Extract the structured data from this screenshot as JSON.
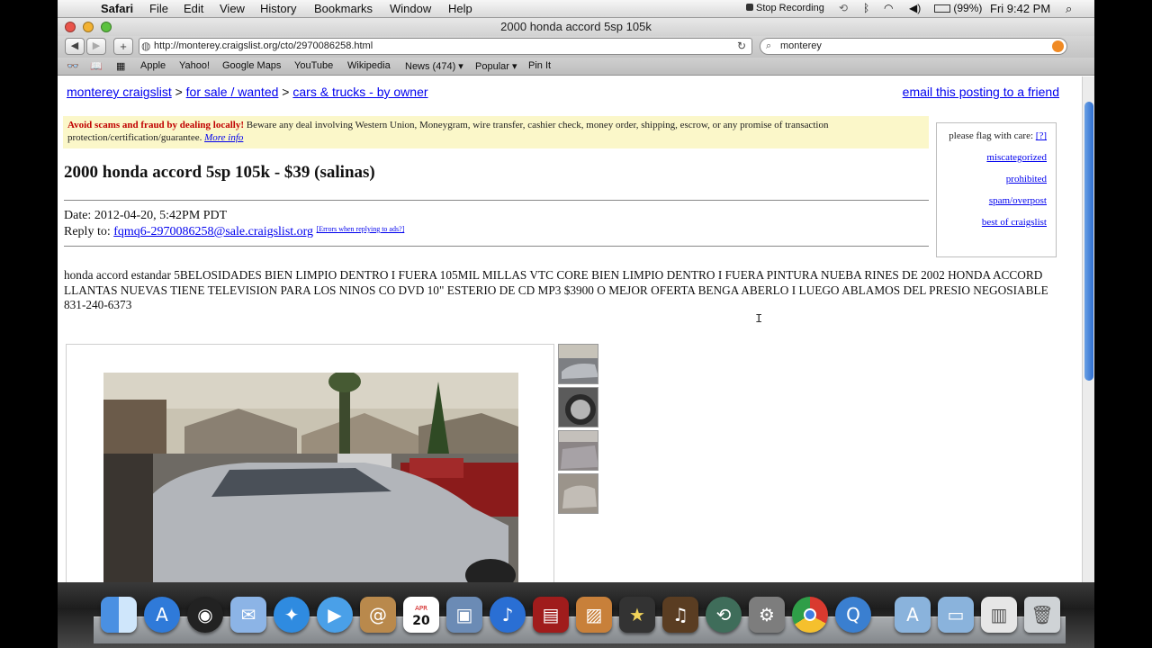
{
  "menubar": {
    "apple_icon": "apple-icon",
    "app_name": "Safari",
    "items": [
      "File",
      "Edit",
      "View",
      "History",
      "Bookmarks",
      "Window",
      "Help"
    ],
    "stop_recording": "Stop Recording",
    "battery": "(99%)",
    "clock": "Fri 9:42 PM"
  },
  "window": {
    "title": "2000 honda accord 5sp 105k"
  },
  "toolbar": {
    "back_label": "◀",
    "forward_label": "▶",
    "add_label": "+",
    "url": "http://monterey.craigslist.org/cto/2970086258.html",
    "search_value": "monterey"
  },
  "bookmarks": [
    "Apple",
    "Yahoo!",
    "Google Maps",
    "YouTube",
    "Wikipedia",
    "News (474) ▾",
    "Popular ▾",
    "Pin It"
  ],
  "page": {
    "breadcrumb": {
      "site": "monterey craigslist",
      "section": "for sale / wanted",
      "category": "cars & trucks - by owner",
      "sep": ">"
    },
    "email_link": "email this posting to a friend",
    "warning": {
      "strong": "Avoid scams and fraud by dealing locally!",
      "text": " Beware any deal involving Western Union, Moneygram, wire transfer, cashier check, money order, shipping, escrow, or any promise of transaction protection/certification/guarantee.",
      "more": "More info"
    },
    "flag": {
      "label": "please flag with care:",
      "help": "[?]",
      "options": [
        "miscategorized",
        "prohibited",
        "spam/overpost",
        "best of craigslist"
      ]
    },
    "title": "2000 honda accord 5sp 105k - $39 (salinas)",
    "date": "Date: 2012-04-20, 5:42PM PDT",
    "reply_prefix": "Reply to:",
    "reply_email": "fqmq6-2970086258@sale.craigslist.org",
    "reply_note": "[Errors when replying to ads?]",
    "body": "honda accord estandar 5BELOSIDADES BIEN LIMPIO DENTRO I FUERA 105MIL MILLAS VTC CORE BIEN LIMPIO DENTRO I FUERA PINTURA NUEBA RINES DE 2002 HONDA ACCORD LLANTAS NUEVAS TIENE TELEVISION PARA LOS NINOS CO DVD 10\" ESTERIO DE CD MP3 $3900 O MEJOR OFERTA BENGA ABERLO I LUEGO ABLAMOS DEL PRESIO NEGOSIABLE 831-240-6373"
  },
  "dock": [
    "finder-icon",
    "app-store-icon",
    "dashboard-icon",
    "mail-icon",
    "safari-icon",
    "facetime-icon",
    "address-book-icon",
    "calendar-icon",
    "iphoto-icon",
    "itunes-icon",
    "photo-booth-icon",
    "preview-icon",
    "imovie-icon",
    "garageband-icon",
    "time-machine-icon",
    "system-preferences-icon",
    "chrome-icon",
    "quicktime-icon",
    "applications-folder-icon",
    "documents-folder-icon",
    "downloads-stack-icon",
    "trash-icon"
  ],
  "dock_calendar": {
    "month": "APR",
    "day": "20"
  },
  "colors": {
    "link": "#0000ee",
    "warning_bg": "#fbf7c9",
    "warning_strong": "#c00000"
  }
}
